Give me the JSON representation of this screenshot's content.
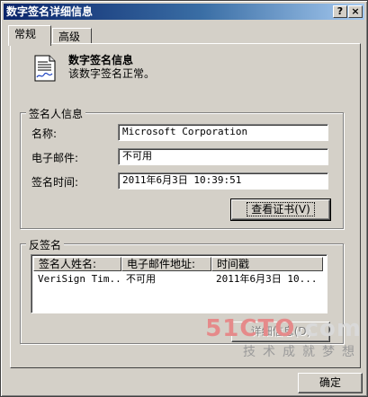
{
  "window": {
    "title": "数字签名详细信息",
    "help_btn": "?",
    "close_btn": "×"
  },
  "tabs": [
    {
      "label": "常规"
    },
    {
      "label": "高级"
    }
  ],
  "info": {
    "heading": "数字签名信息",
    "message": "该数字签名正常。"
  },
  "signer": {
    "legend": "签名人信息",
    "name_label": "名称:",
    "name_value": "Microsoft Corporation",
    "email_label": "电子邮件:",
    "email_value": "不可用",
    "time_label": "签名时间:",
    "time_value": "2011年6月3日  10:39:51",
    "view_cert_label": "查看证书(V)"
  },
  "countersign": {
    "legend": "反签名",
    "columns": [
      "签名人姓名:",
      "电子邮件地址:",
      "时间戳"
    ],
    "rows": [
      [
        "VeriSign Tim...",
        "不可用",
        "2011年6月3日  10..."
      ]
    ],
    "details_label": "详细信息(D)"
  },
  "footer": {
    "ok_label": "确定"
  },
  "watermark": {
    "logo_prefix": "51CTO",
    "logo_suffix": ".com",
    "tagline": "技术成就梦想"
  }
}
